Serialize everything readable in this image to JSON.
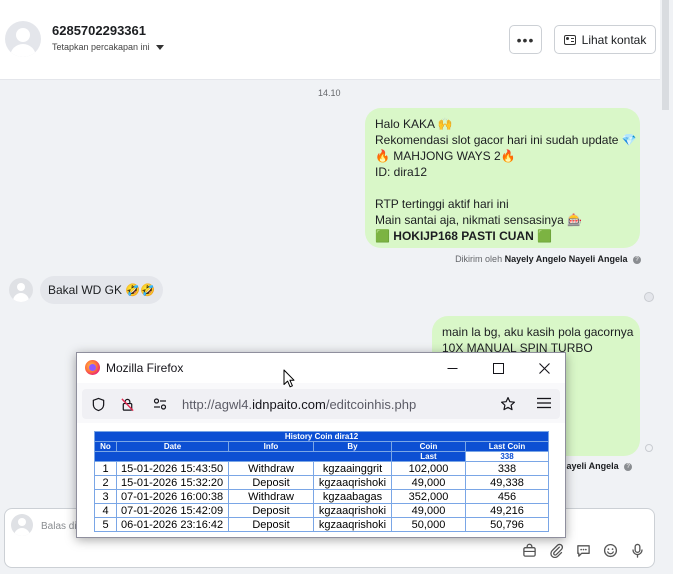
{
  "header": {
    "contact_name": "6285702293361",
    "pin_label": "Tetapkan percakapan ini",
    "more_label": "•••",
    "view_contact_label": "Lihat kontak"
  },
  "timestamp": "14.10",
  "messages": {
    "outgoing_1": {
      "lines": [
        "Halo KAKA 🙌",
        "Rekomendasi slot gacor hari ini sudah update 💎",
        "🔥 MAHJONG WAYS 2🔥",
        "ID:  dira12",
        "",
        "RTP tertinggi aktif hari ini",
        "Main santai aja, nikmati sensasinya 🎰"
      ],
      "bold_line": "🟩 HOKIJP168 PASTI CUAN 🟩",
      "sent_by_prefix": "Dikirim oleh",
      "sent_by_name": "Nayely Angelo Nayeli Angela"
    },
    "incoming_1": {
      "text": "Bakal WD GK 🤣🤣"
    },
    "outgoing_2": {
      "lines": [
        "main la bg, aku kasih pola gacornya",
        "10X MANUAL SPIN TURBO"
      ],
      "sent_by_name_partial": "Nayeli Angela"
    }
  },
  "composer": {
    "placeholder": "Balas di Messenger"
  },
  "firefox": {
    "title": "Mozilla Firefox",
    "url_prefix": "http://agwl4.",
    "url_domain": "idnpaito.com",
    "url_path": "/editcoinhis.php",
    "table": {
      "title": "History Coin dira12",
      "columns": [
        "No",
        "Date",
        "Info",
        "By",
        "Coin",
        "Last Coin"
      ],
      "sub_coin": "Last",
      "sub_last": "338",
      "rows": [
        [
          "1",
          "15-01-2026 15:43:50",
          "Withdraw",
          "kgzaainggrit",
          "102,000",
          "338"
        ],
        [
          "2",
          "15-01-2026 15:32:20",
          "Deposit",
          "kgzaaqrishoki",
          "49,000",
          "49,338"
        ],
        [
          "3",
          "07-01-2026 16:00:38",
          "Withdraw",
          "kgzaabagas",
          "352,000",
          "456"
        ],
        [
          "4",
          "07-01-2026 15:42:09",
          "Deposit",
          "kgzaaqrishoki",
          "49,000",
          "49,216"
        ],
        [
          "5",
          "06-01-2026 23:16:42",
          "Deposit",
          "kgzaaqrishoki",
          "50,000",
          "50,796"
        ]
      ]
    }
  }
}
